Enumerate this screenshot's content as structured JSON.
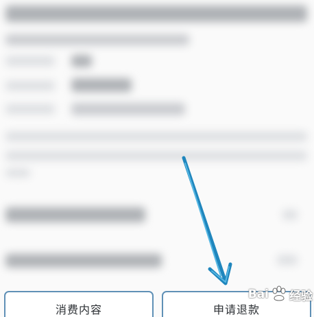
{
  "actions": {
    "left_button_label": "消费内容",
    "right_button_label": "申请退款"
  },
  "watermark": {
    "text_prefix": "Bai",
    "text_suffix": "经验"
  },
  "colors": {
    "button_border": "#5f90b6",
    "arrow": "#2a95c9",
    "background": "#fafafa"
  },
  "icons": {
    "annotation": "pointer-arrow-annotation",
    "watermark": "paw-icon"
  }
}
